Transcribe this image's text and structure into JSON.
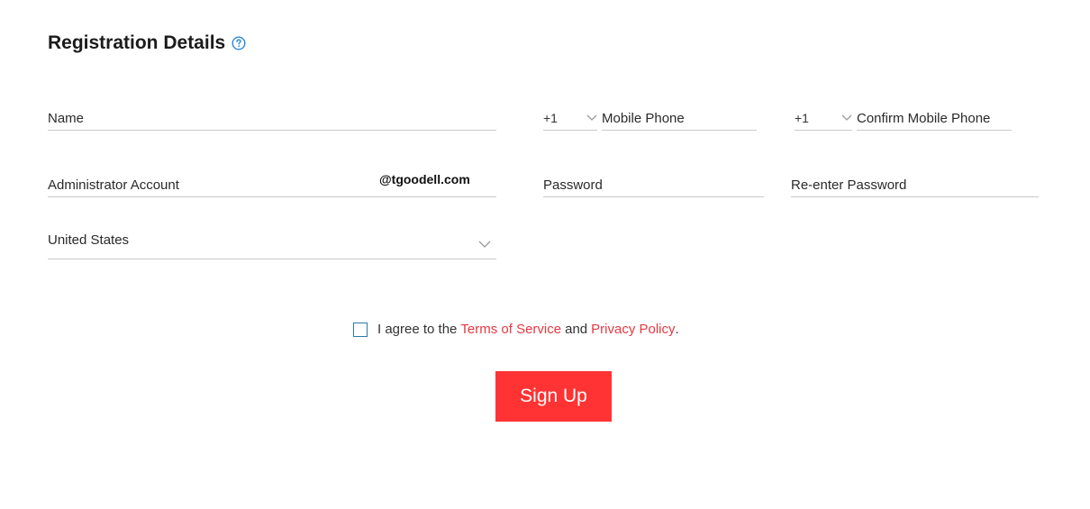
{
  "page": {
    "title": "Registration Details",
    "help_icon": "question-circle-icon",
    "accent_color": "#ff3333",
    "link_color": "#e63940"
  },
  "form": {
    "name_placeholder": "Name",
    "mobile_code": "+1",
    "mobile_placeholder": "Mobile Phone",
    "confirm_code": "+1",
    "confirm_mobile_placeholder": "Confirm Mobile Phone",
    "admin_placeholder": "Administrator Account",
    "admin_domain": "@tgoodell.com",
    "password_placeholder": "Password",
    "reenter_password_placeholder": "Re-enter Password",
    "country_value": "United States"
  },
  "agreement": {
    "prefix": "I agree to the",
    "terms_link": "Terms of Service",
    "and": "and",
    "privacy_link": "Privacy Policy",
    "suffix": "."
  },
  "actions": {
    "signup_label": "Sign Up"
  }
}
